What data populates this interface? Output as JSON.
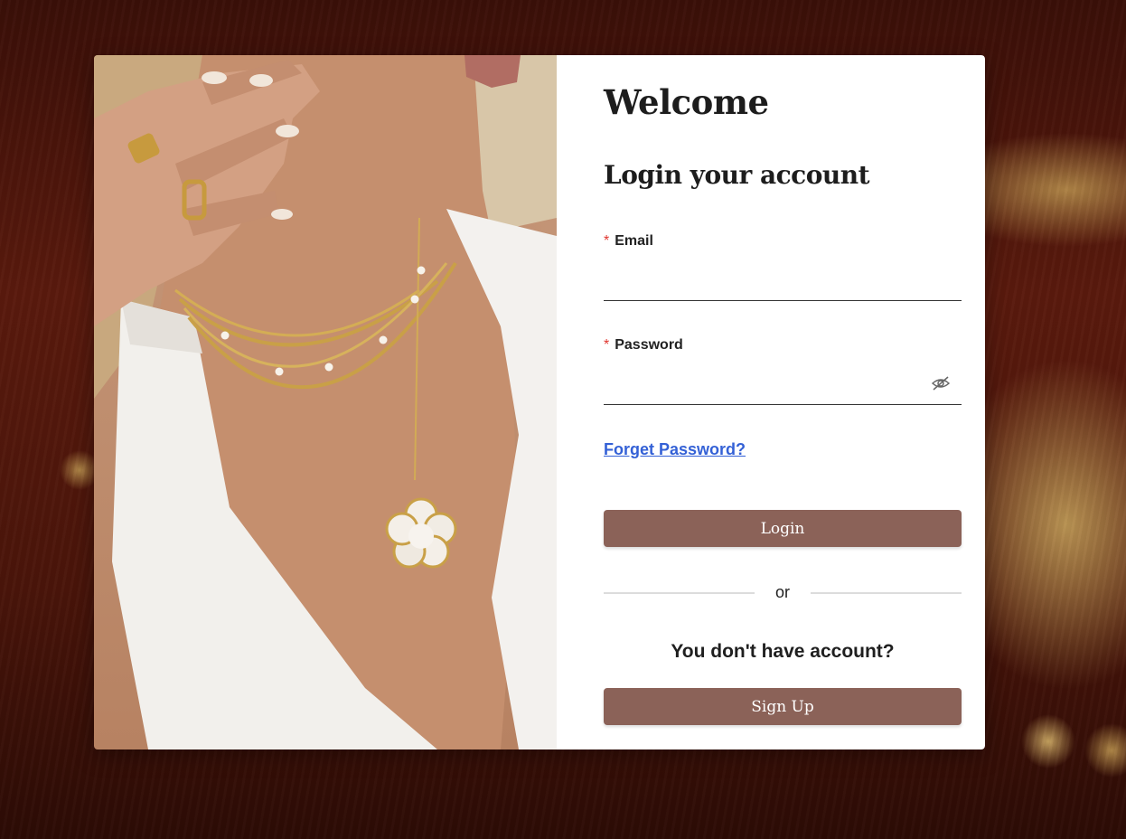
{
  "panel": {
    "welcome": "Welcome",
    "heading": "Login your account",
    "email": {
      "label": "Email",
      "required_mark": "*",
      "value": "",
      "placeholder": ""
    },
    "password": {
      "label": "Password",
      "required_mark": "*",
      "value": "",
      "placeholder": "",
      "toggle_icon": "eye-slash-icon"
    },
    "forget_password": "Forget Password?",
    "login_button": "Login",
    "divider_text": "or",
    "no_account_text": "You don't have account?",
    "signup_button": "Sign Up"
  },
  "colors": {
    "button": "#8b6258",
    "link": "#3461d6",
    "required": "#e0362f",
    "backdrop": "#4a150a"
  }
}
